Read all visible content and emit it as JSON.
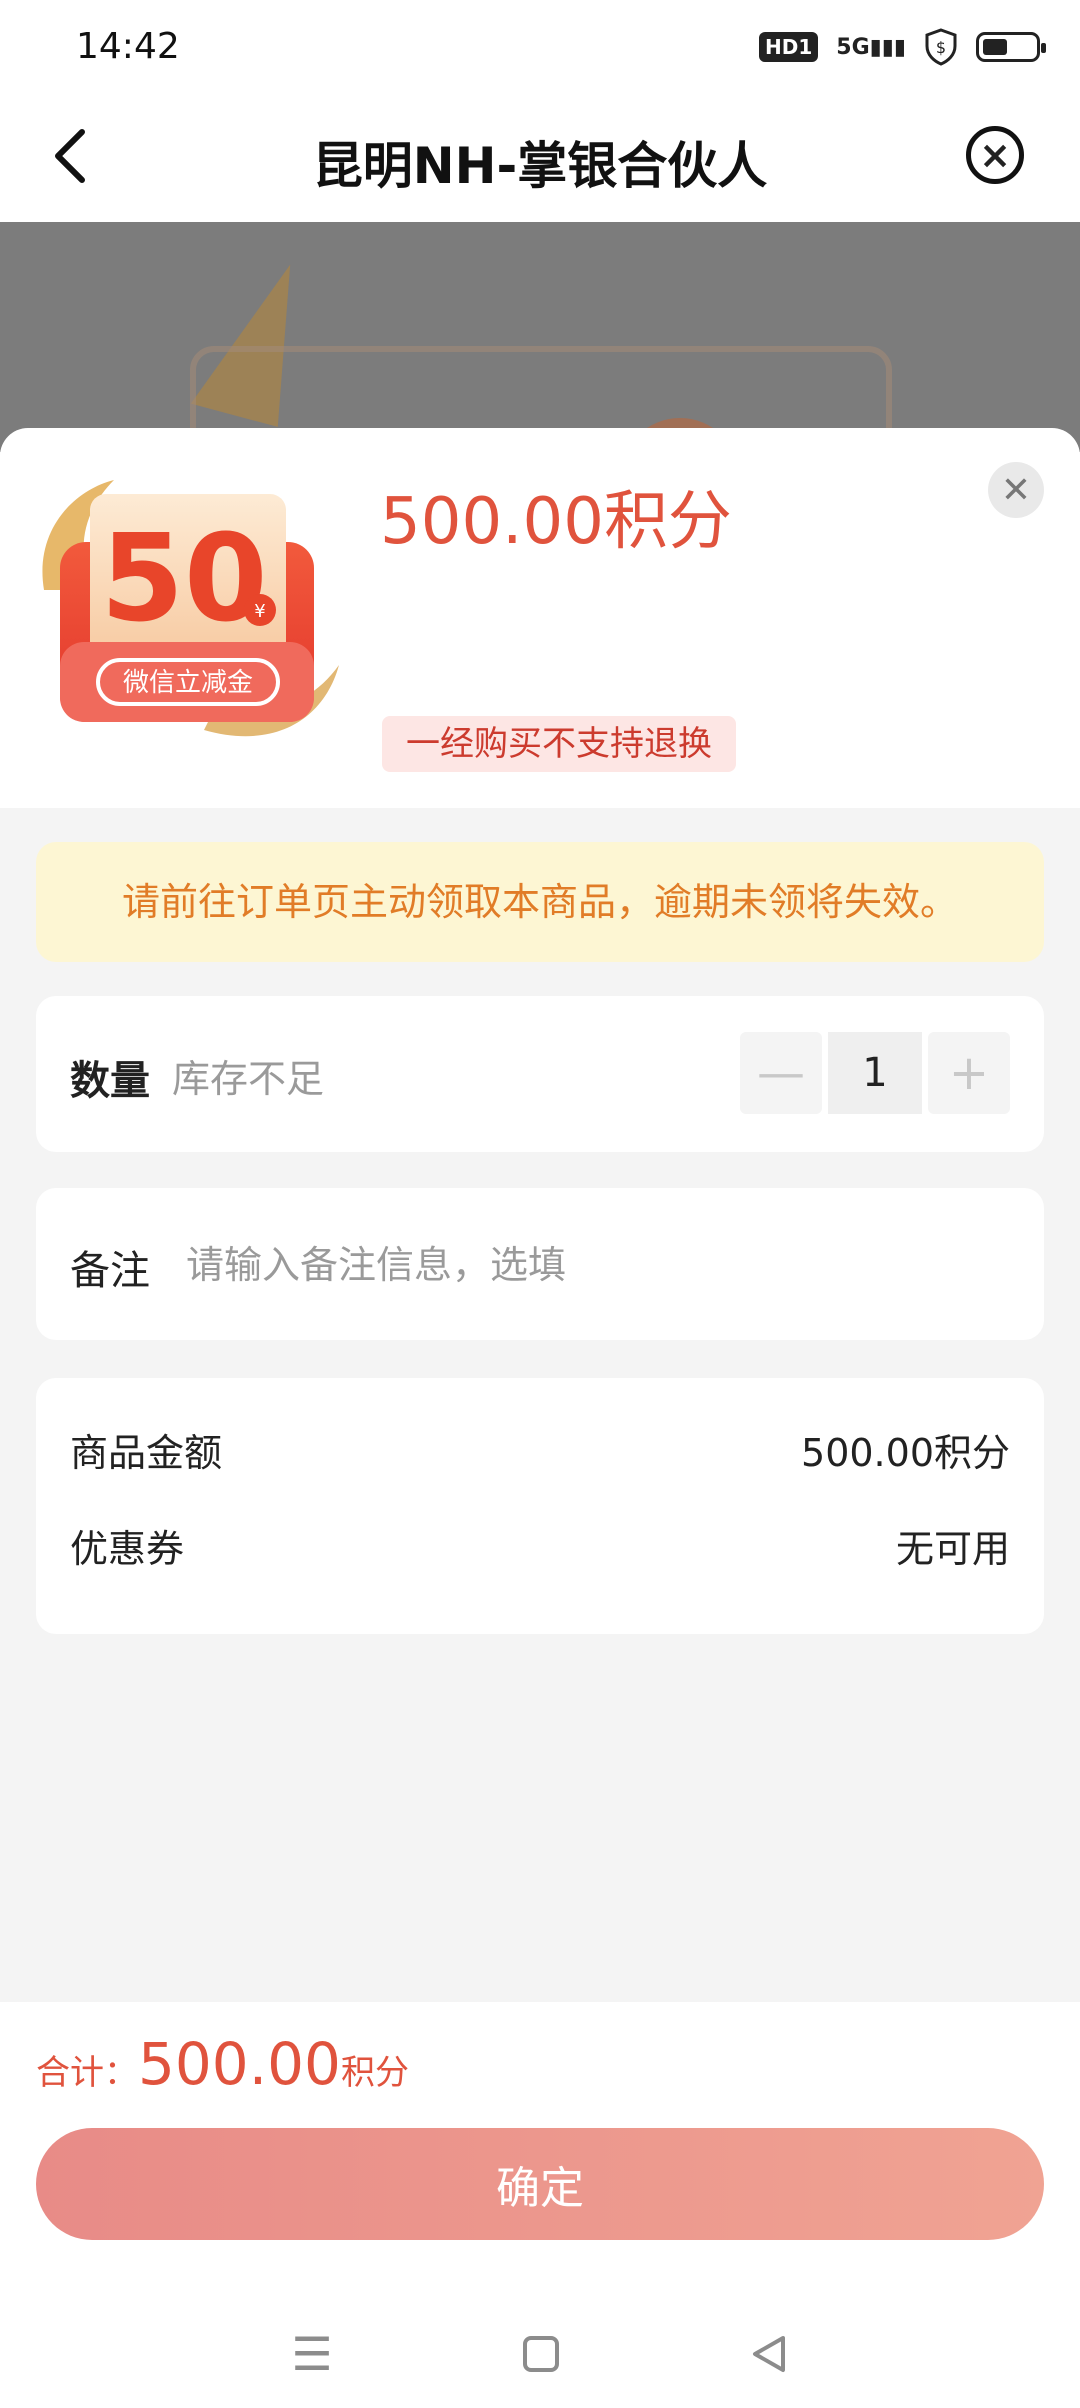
{
  "status_bar": {
    "time": "14:42",
    "badge": "HD1",
    "network": "5G"
  },
  "header": {
    "title": "昆明NH-掌银合伙人"
  },
  "product": {
    "image_value": "50",
    "image_caption": "微信立减金",
    "price": "500.00积分",
    "return_policy": "一经购买不支持退换"
  },
  "notice": {
    "text": "请前往订单页主动领取本商品，逾期未领将失效。"
  },
  "quantity": {
    "label": "数量",
    "stock_status": "库存不足",
    "value": "1",
    "minus": "—",
    "plus": "+"
  },
  "remark": {
    "label": "备注",
    "placeholder": "请输入备注信息，选填"
  },
  "summary": {
    "rows": [
      {
        "label": "商品金额",
        "value": "500.00积分"
      },
      {
        "label": "优惠券",
        "value": "无可用"
      }
    ]
  },
  "footer": {
    "total_label": "合计：",
    "total_amount": "500.00",
    "total_unit": "积分",
    "confirm_label": "确定"
  },
  "colors": {
    "accent": "#e0533d",
    "notice_text": "#e17c27",
    "notice_bg": "#fdf6d3",
    "confirm_bg": "#ea8f89"
  }
}
